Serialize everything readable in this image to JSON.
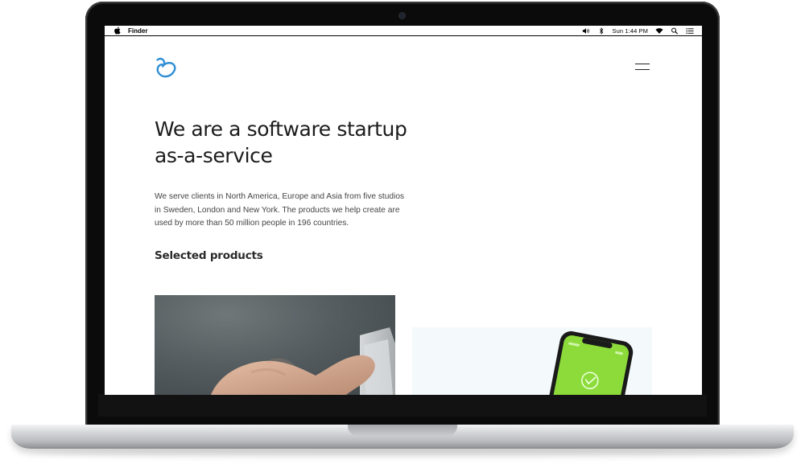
{
  "menubar": {
    "app_name": "Finder",
    "clock": "Sun 1:44 PM",
    "icons": [
      "apple-icon",
      "volume-icon",
      "bluetooth-icon",
      "wifi-icon",
      "spotlight-search-icon",
      "notification-list-icon"
    ]
  },
  "site": {
    "headline_line1": "We are a software startup",
    "headline_line2": "as-a-service",
    "intro": "We serve clients in North America, Europe and Asia from five studios in Sweden, London and New York. The products we help create are used by more than 50 million people in 196 countries.",
    "section_heading": "Selected products",
    "nav_icon": "hamburger-menu-icon",
    "logo_icon": "heart-swirl-logo",
    "accent_color": "#2f8fd6",
    "phone_screen_color": "#8ddb3a"
  }
}
